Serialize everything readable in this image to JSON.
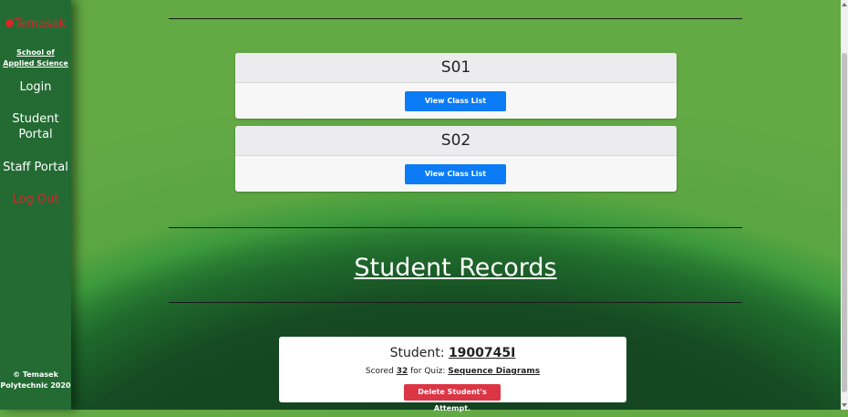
{
  "sidebar": {
    "logo_text": "Temasek",
    "school_name": "School of Applied Science",
    "nav": {
      "login": "Login",
      "student_portal_line1": "Student",
      "student_portal_line2": "Portal",
      "staff_portal": "Staff Portal",
      "logout": "Log Out"
    },
    "copyright_line1": "© Temasek",
    "copyright_line2": "Polytechnic 2020"
  },
  "classes": [
    {
      "name": "S01",
      "button_label": "View Class List"
    },
    {
      "name": "S02",
      "button_label": "View Class List"
    }
  ],
  "records": {
    "title": "Student Records",
    "student_label": "Student:",
    "student_id": "1900745I",
    "scored_prefix": "Scored",
    "score": "32",
    "for_quiz_text": "for Quiz:",
    "quiz_name": "Sequence Diagrams",
    "delete_label": "Delete Student's Attempt."
  },
  "colors": {
    "sidebar_bg": "#236b33",
    "primary_button": "#0b7bf6",
    "danger_button": "#dc3545",
    "logo_red": "#d9262b"
  }
}
